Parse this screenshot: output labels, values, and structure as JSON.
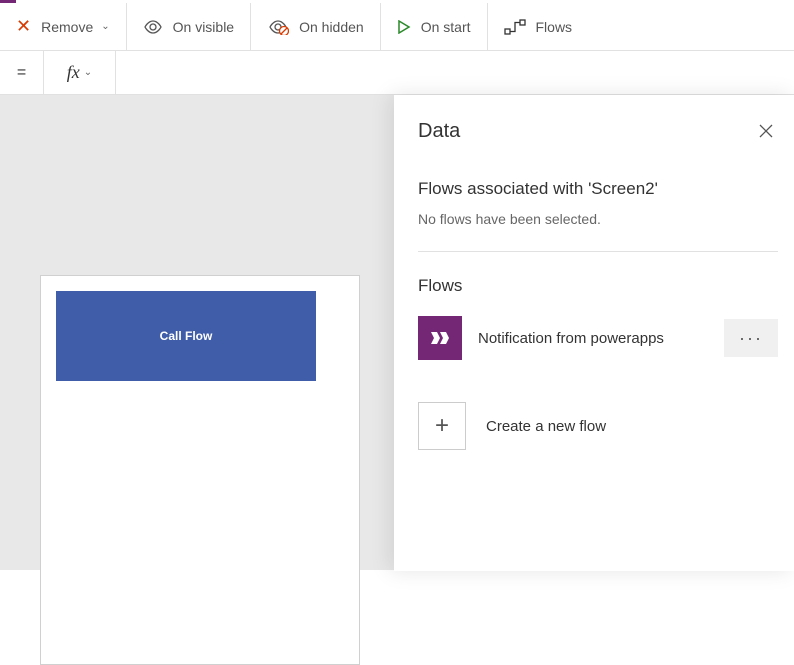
{
  "toolbar": {
    "remove_label": "Remove",
    "on_visible_label": "On visible",
    "on_hidden_label": "On hidden",
    "on_start_label": "On start",
    "flows_label": "Flows"
  },
  "formula_bar": {
    "eq": "=",
    "fx": "fx",
    "value": ""
  },
  "canvas": {
    "button_label": "Call Flow"
  },
  "panel": {
    "title": "Data",
    "associated_heading": "Flows associated with 'Screen2'",
    "associated_empty": "No flows have been selected.",
    "flows_heading": "Flows",
    "flow_items": [
      {
        "name": "Notification from powerapps"
      }
    ],
    "create_label": "Create a new flow"
  }
}
